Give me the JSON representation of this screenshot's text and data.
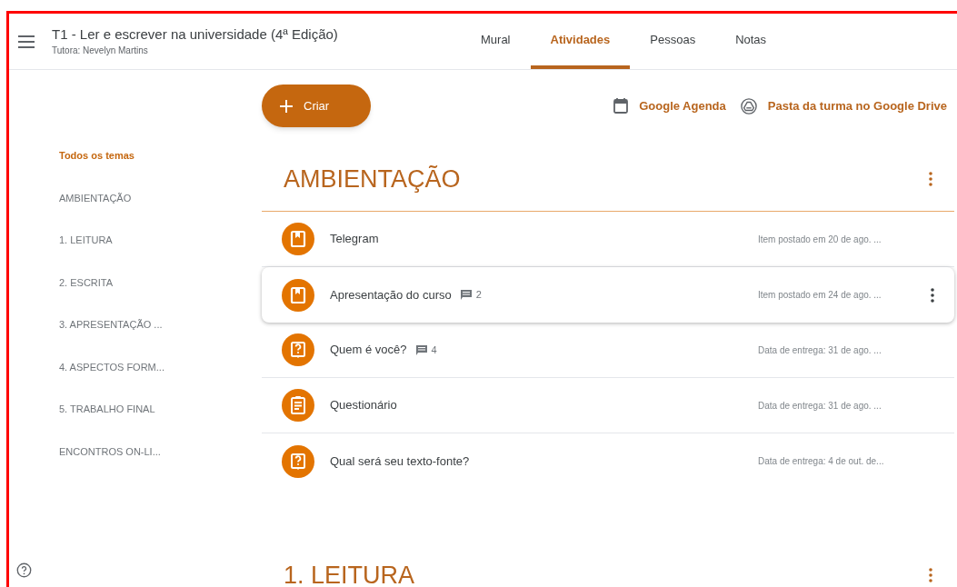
{
  "header": {
    "title": "T1 - Ler e escrever na universidade (4ª Edição)",
    "subtitle": "Tutora: Nevelyn Martins"
  },
  "tabs": [
    {
      "label": "Mural",
      "selected": false
    },
    {
      "label": "Atividades",
      "selected": true
    },
    {
      "label": "Pessoas",
      "selected": false
    },
    {
      "label": "Notas",
      "selected": false
    }
  ],
  "create_button": {
    "label": "Criar"
  },
  "links": [
    {
      "kind": "calendar",
      "label": "Google Agenda"
    },
    {
      "kind": "drive",
      "label": "Pasta da turma no Google Drive"
    }
  ],
  "topics": [
    {
      "label": "Todos os temas",
      "selected": true
    },
    {
      "label": "AMBIENTAÇÃO",
      "selected": false
    },
    {
      "label": "1. LEITURA",
      "selected": false
    },
    {
      "label": "2. ESCRITA",
      "selected": false
    },
    {
      "label": "3. APRESENTAÇÃO ...",
      "selected": false
    },
    {
      "label": "4. ASPECTOS FORM...",
      "selected": false
    },
    {
      "label": "5. TRABALHO FINAL",
      "selected": false
    },
    {
      "label": "ENCONTROS ON-LI...",
      "selected": false
    }
  ],
  "sections": [
    {
      "title": "AMBIENTAÇÃO",
      "items": [
        {
          "kind": "material",
          "title": "Telegram",
          "date": "Item postado em 20 de ago. ...",
          "highlighted": false
        },
        {
          "kind": "material",
          "title": "Apresentação do curso",
          "comments": "2",
          "date": "Item postado em 24 de ago. ...",
          "highlighted": true
        },
        {
          "kind": "question",
          "title": "Quem é você?",
          "comments": "4",
          "date": "Data de entrega: 31 de ago. ...",
          "highlighted": false
        },
        {
          "kind": "assignment",
          "title": "Questionário",
          "date": "Data de entrega: 31 de ago. ...",
          "highlighted": false
        },
        {
          "kind": "question",
          "title": "Qual será seu texto-fonte?",
          "date": "Data de entrega: 4 de out. de...",
          "highlighted": false
        }
      ]
    },
    {
      "title": "1. LEITURA"
    }
  ]
}
